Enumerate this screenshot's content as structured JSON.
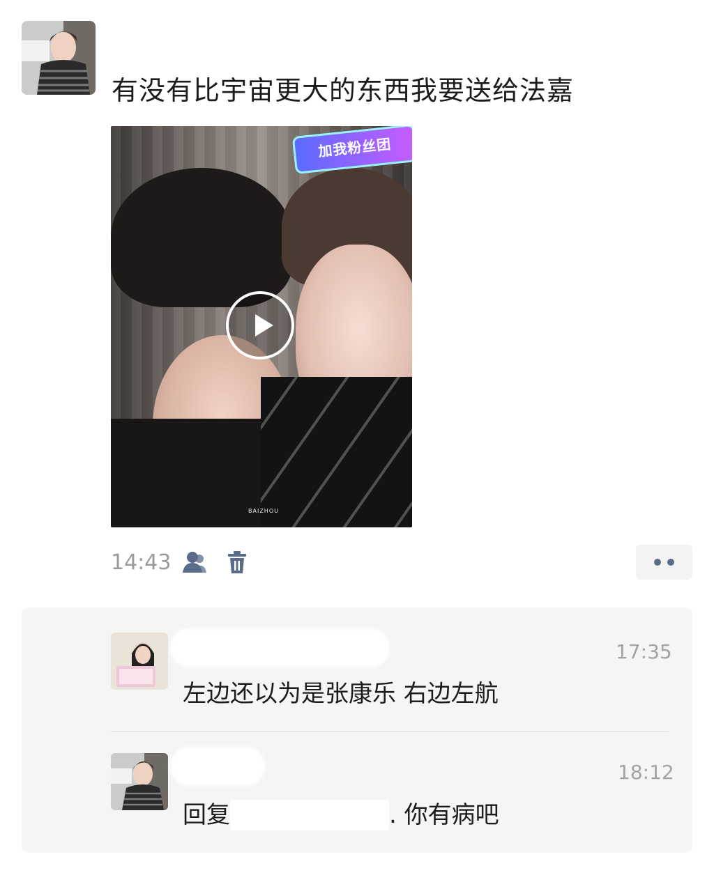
{
  "post": {
    "text": "有没有比宇宙更大的东西我要送给法嘉",
    "time": "14:43",
    "video": {
      "badge_text": "加我粉丝团",
      "watermark": "BAIZHOU"
    },
    "icons": {
      "share": "friends-visibility-icon",
      "delete": "trash-icon",
      "more": "more-dots-icon"
    }
  },
  "comments": [
    {
      "time": "17:35",
      "text": "左边还以为是张康乐 右边左航"
    },
    {
      "time": "18:12",
      "reply_prefix": "回复",
      "text": ". 你有病吧"
    }
  ],
  "colors": {
    "icon_blue": "#5b6b8c",
    "comment_bg": "#f5f5f5",
    "meta_gray": "#9a9a9a"
  }
}
